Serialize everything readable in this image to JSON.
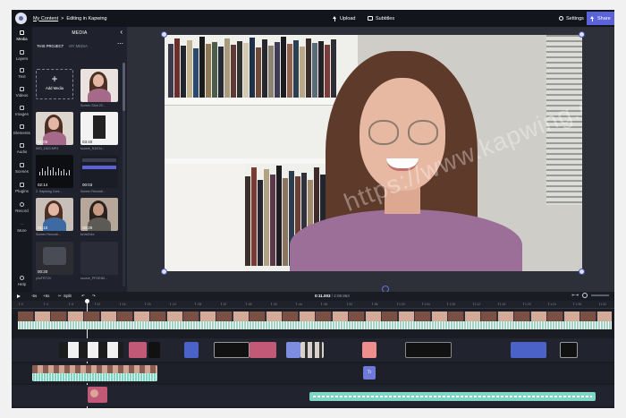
{
  "topbar": {
    "breadcrumb_link": "My Content",
    "breadcrumb_sep": ">",
    "breadcrumb_current": "Editing in Kapwing",
    "upload_label": "Upload",
    "subtitles_label": "Subtitles",
    "settings_label": "Settings",
    "share_label": "Share"
  },
  "rail": {
    "items": [
      {
        "label": "Media"
      },
      {
        "label": "Layers"
      },
      {
        "label": "Text"
      },
      {
        "label": "Videos"
      },
      {
        "label": "Images"
      },
      {
        "label": "Elements"
      },
      {
        "label": "Audio"
      },
      {
        "label": "Scenes"
      },
      {
        "label": "Plugins"
      },
      {
        "label": "Record"
      },
      {
        "label": "More"
      },
      {
        "label": "Help"
      }
    ]
  },
  "media": {
    "title": "MEDIA",
    "tab_project": "THIS PROJECT",
    "tab_my_media": "MY MEDIA",
    "add_media_label": "Add Media",
    "tiles": [
      {
        "duration": "",
        "caption": "Screen Shot 20..."
      },
      {
        "duration": "01:05",
        "caption": "IMG_1823.MP4"
      },
      {
        "duration": "03:40",
        "caption": "source_N1t21x..."
      },
      {
        "duration": "02:14",
        "caption": "2. Kapwing Cont..."
      },
      {
        "duration": "00:03",
        "caption": "Screen Recordi..."
      },
      {
        "duration": "01:10",
        "caption": "Screen Recordi..."
      },
      {
        "duration": "00:29",
        "caption": "kzVeZxkx"
      },
      {
        "duration": "00:20",
        "caption": "y0uTRTZV"
      },
      {
        "duration": "",
        "caption": "source_PFGEN0..."
      }
    ]
  },
  "preview": {
    "watermark": "https://www.kapwing.com"
  },
  "timeline": {
    "rewind_label": "-5s",
    "forward_label": "+5s",
    "split_label": "Split",
    "current_time": "0:11.003",
    "total_time": "/ 2:08.963",
    "ticks": [
      ":0",
      ":4",
      ":8",
      ":12",
      ":16",
      ":20",
      ":24",
      ":28",
      ":32",
      ":36",
      ":40",
      ":44",
      ":48",
      ":52",
      ":56",
      "1:00",
      "1:04",
      "1:08",
      "1:12",
      "1:16",
      "1:20",
      "1:24",
      "1:28",
      "1:32"
    ],
    "text_track_badge": "Tr"
  },
  "colors": {
    "accent": "#5a63d8",
    "background": "#1d2029",
    "audio_track": "#7fd6c4"
  }
}
